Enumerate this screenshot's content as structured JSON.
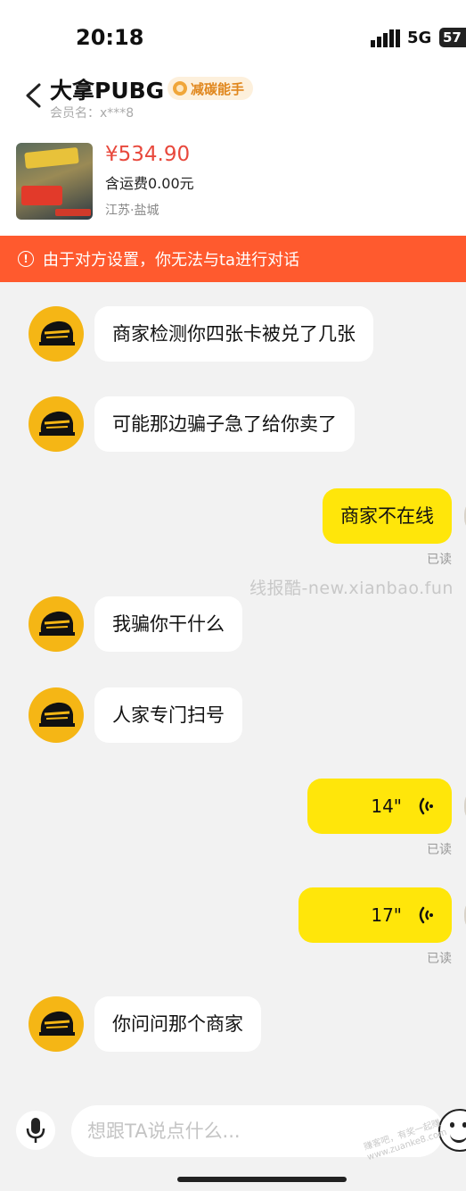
{
  "status_bar": {
    "time": "20:18",
    "network": "5G",
    "battery": "57"
  },
  "header": {
    "shop_name": "大拿PUBG",
    "badge": "减碳能手",
    "member": "会员名：x***8"
  },
  "product": {
    "price": "¥534.90",
    "shipping": "含运费0.00元",
    "location": "江苏·盐城"
  },
  "notice": {
    "icon": "!",
    "text": "由于对方设置，你无法与ta进行对话"
  },
  "messages": [
    {
      "side": "left",
      "text": "商家检测你四张卡被兑了几张"
    },
    {
      "side": "left",
      "text": "可能那边骗子急了给你卖了"
    },
    {
      "side": "right",
      "text": "商家不在线",
      "status": "已读"
    },
    {
      "side": "left",
      "text": "我骗你干什么"
    },
    {
      "side": "left",
      "text": "人家专门扫号"
    },
    {
      "side": "right",
      "voice_duration": "14\"",
      "status": "已读"
    },
    {
      "side": "right",
      "voice_duration": "17\"",
      "status": "已读"
    },
    {
      "side": "left",
      "text": "你问问那个商家"
    }
  ],
  "watermark": "线报酷-new.xianbao.fun",
  "corner_watermark": "赚客吧，有奖一起赚 www.zuanke8.com",
  "input": {
    "placeholder": "想跟TA说点什么..."
  },
  "icons": {
    "back": "chevron-left-icon",
    "mic": "microphone-icon",
    "emoji": "smiley-icon",
    "voice": "voice-wave-icon"
  },
  "colors": {
    "notice_bg": "#ff5a2e",
    "my_bubble": "#ffe60a",
    "price": "#e8483c",
    "avatar_bg": "#f5b615"
  }
}
